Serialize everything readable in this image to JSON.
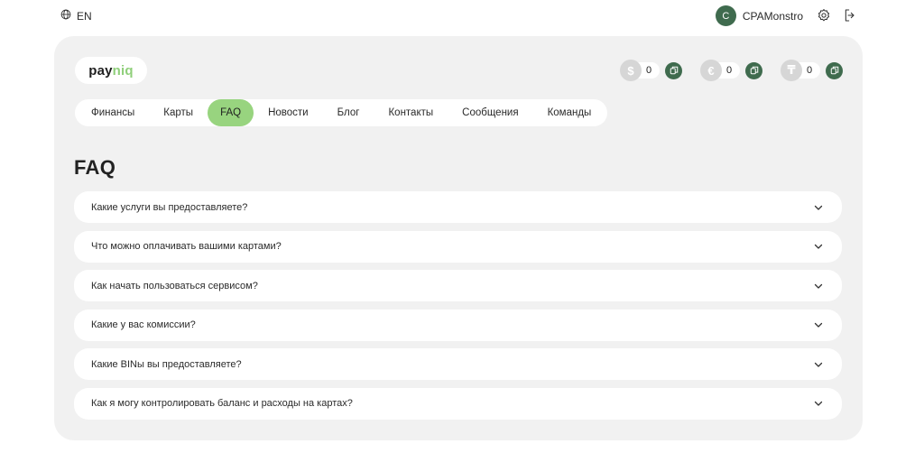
{
  "topbar": {
    "language": "EN",
    "user": {
      "initial": "C",
      "name": "CPAMonstro"
    }
  },
  "logo": {
    "part1": "pay",
    "part2": "niq"
  },
  "balances": [
    {
      "symbol": "$",
      "amount": "0"
    },
    {
      "symbol": "€",
      "amount": "0"
    },
    {
      "symbol": "₸",
      "amount": "0"
    }
  ],
  "nav": {
    "items": [
      "Финансы",
      "Карты",
      "FAQ",
      "Новости",
      "Блог",
      "Контакты",
      "Сообщения",
      "Команды"
    ],
    "active": "FAQ"
  },
  "page": {
    "title": "FAQ"
  },
  "faq": {
    "items": [
      "Какие услуги вы предоставляете?",
      "Что можно оплачивать вашими картами?",
      "Как начать пользоваться сервисом?",
      "Какие у вас комиссии?",
      "Какие BINы вы предоставляете?",
      "Как я могу контролировать баланс и расходы на картах?"
    ]
  },
  "colors": {
    "accent": "#98d47f",
    "brand_dark": "#3f6b4e",
    "card_bg": "#f1f1f1"
  },
  "icons": {
    "language": "globe-icon",
    "settings": "gear-icon",
    "logout": "logout-icon",
    "copy": "copy-icon",
    "expand": "chevron-down-icon"
  }
}
